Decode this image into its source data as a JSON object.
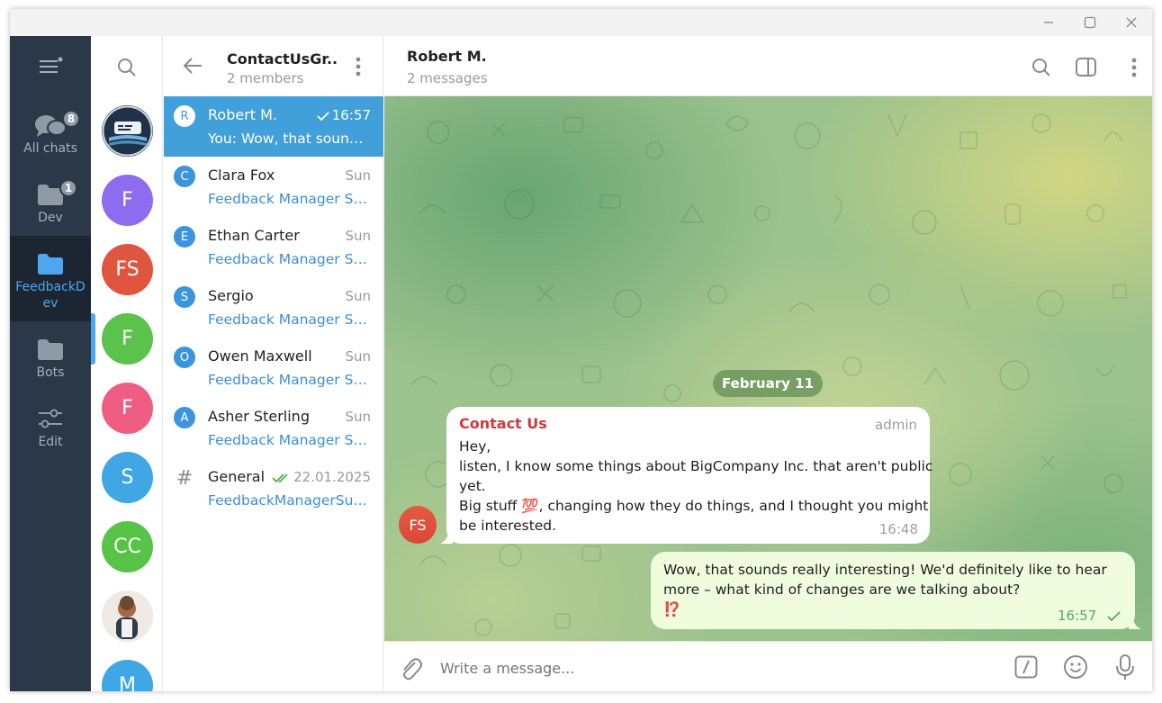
{
  "folders": [
    {
      "label": "All chats",
      "badge": "8",
      "icon": "chats-icon"
    },
    {
      "label": "Dev",
      "badge": "1",
      "icon": "folder-icon"
    },
    {
      "label": "FeedbackD\nev",
      "icon": "folder-icon",
      "active": true
    },
    {
      "label": "Bots",
      "icon": "folder-icon"
    },
    {
      "label": "Edit",
      "icon": "sliders-icon"
    }
  ],
  "strip_avatars": [
    {
      "text": "",
      "kind": "bot-logo"
    },
    {
      "text": "F",
      "color": "#8e6cf0"
    },
    {
      "text": "FS",
      "color": "#e0553d"
    },
    {
      "text": "F",
      "color": "#5bc24b"
    },
    {
      "text": "F",
      "color": "#ef5e82"
    },
    {
      "text": "S",
      "color": "#3fa7e3"
    },
    {
      "text": "CC",
      "color": "#57c447"
    },
    {
      "text": "",
      "kind": "photo"
    },
    {
      "text": "M",
      "color": "#3fa7e3"
    }
  ],
  "group": {
    "title": "ContactUsGr..",
    "subtitle": "2 members"
  },
  "chats": [
    {
      "initial": "R",
      "name": "Robert M.",
      "time": "16:57",
      "preview": "You: Wow, that sounds...",
      "selected": true,
      "status": "sent"
    },
    {
      "initial": "C",
      "name": "Clara Fox",
      "time": "Sun",
      "preview": "Feedback Manager Su..."
    },
    {
      "initial": "E",
      "name": "Ethan Carter",
      "time": "Sun",
      "preview": "Feedback Manager Su..."
    },
    {
      "initial": "S",
      "name": "Sergio",
      "time": "Sun",
      "preview": "Feedback Manager Su..."
    },
    {
      "initial": "O",
      "name": "Owen Maxwell",
      "time": "Sun",
      "preview": "Feedback Manager Su..."
    },
    {
      "initial": "A",
      "name": "Asher Sterling",
      "time": "Sun",
      "preview": "Feedback Manager Su..."
    },
    {
      "initial": "#",
      "name": "General",
      "time": "22.01.2025",
      "preview": "FeedbackManagerSup...",
      "status": "read",
      "topic": true
    }
  ],
  "chat_header": {
    "name": "Robert M.",
    "subtitle": "2 messages"
  },
  "date_pill": "February 11",
  "incoming": {
    "sender": "Contact Us",
    "role": "admin",
    "lines": [
      "Hey,",
      "listen, I know some things about BigCompany Inc. that aren't public",
      "yet.",
      "Big stuff 💯, changing how they do things, and I thought you might",
      "be interested."
    ],
    "time": "16:48",
    "avatar": "FS"
  },
  "outgoing": {
    "lines": [
      "Wow, that sounds really interesting!  We'd definitely like to hear",
      "more – what kind of changes are we talking about?",
      "⁉️"
    ],
    "time": "16:57"
  },
  "composer": {
    "placeholder": "Write a message..."
  },
  "colors": {
    "accent": "#419fd9",
    "rail": "#2a3848",
    "sender": "#d0393d",
    "outgoing_bubble": "#effcde"
  }
}
